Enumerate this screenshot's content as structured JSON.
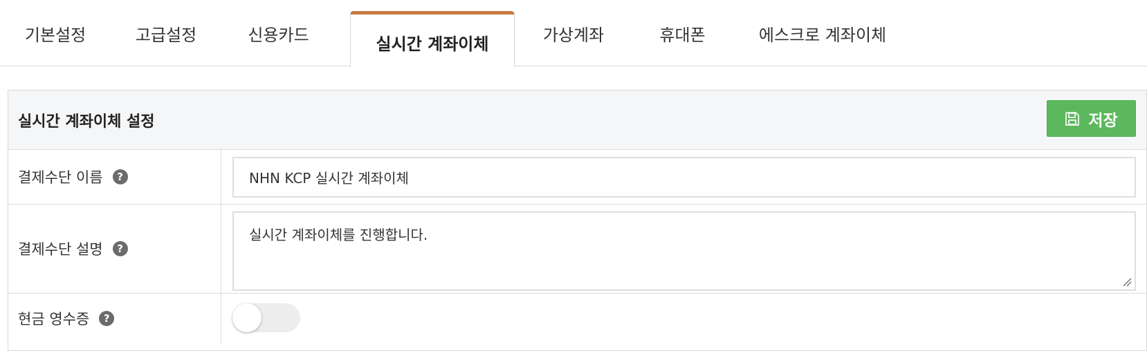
{
  "tabs": [
    {
      "label": "기본설정",
      "active": false
    },
    {
      "label": "고급설정",
      "active": false
    },
    {
      "label": "신용카드",
      "active": false
    },
    {
      "label": "실시간 계좌이체",
      "active": true
    },
    {
      "label": "가상계좌",
      "active": false
    },
    {
      "label": "휴대폰",
      "active": false
    },
    {
      "label": "에스크로 계좌이체",
      "active": false
    }
  ],
  "panel": {
    "title": "실시간 계좌이체 설정",
    "save_label": "저장",
    "save_icon": "floppy-disk-icon"
  },
  "fields": {
    "name": {
      "label": "결제수단 이름",
      "value": "NHN KCP 실시간 계좌이체",
      "help_icon": "question-circle-icon"
    },
    "description": {
      "label": "결제수단 설명",
      "value": "실시간 계좌이체를 진행합니다.",
      "help_icon": "question-circle-icon"
    },
    "cash_receipt": {
      "label": "현금 영수증",
      "enabled": false,
      "help_icon": "question-circle-icon"
    }
  },
  "colors": {
    "active_tab_accent": "#c87a40",
    "save_button": "#5cb85c",
    "help_icon": "#6b6b6b"
  }
}
